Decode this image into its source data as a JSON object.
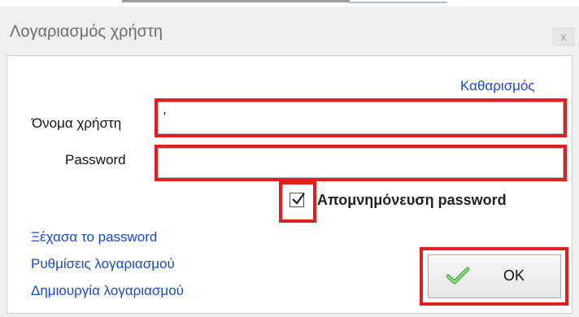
{
  "window": {
    "title": "Λογαριασμός χρήστη",
    "close_glyph": "x"
  },
  "links": {
    "clear": "Καθαρισμός",
    "forgot_password": "Ξέχασα το password",
    "account_settings": "Ρυθμίσεις λογαριασμού",
    "create_account": "Δημιουργία λογαριασμού"
  },
  "form": {
    "username_label": "Όνομα χρήστη",
    "username_value": "'",
    "password_label": "Password",
    "password_value": "",
    "remember_label": "Απομνημόνευση password",
    "remember_checked": true
  },
  "buttons": {
    "ok": "OK"
  },
  "colors": {
    "link": "#1b47c9",
    "highlight": "#e02020",
    "check_icon": "#4caf50"
  },
  "icons": {
    "ok_icon": "checkmark-icon",
    "close_icon": "close-icon"
  }
}
